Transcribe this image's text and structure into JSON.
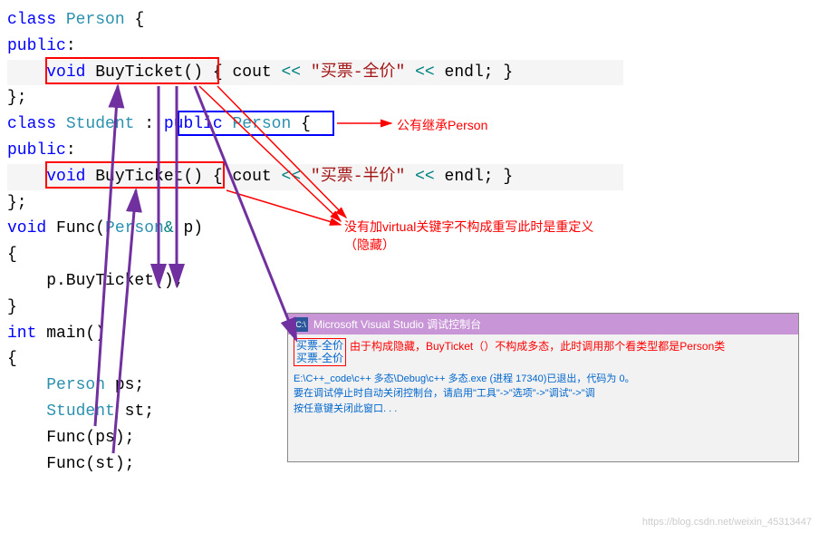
{
  "code": {
    "l1_class": "class",
    "l1_person": "Person",
    "l1_brace": " {",
    "l2_public": "public",
    "l2_colon": ":",
    "l3_void": "void",
    "l3_fn": " BuyTicket",
    "l3_parens": "()",
    "l3_open": " { ",
    "l3_cout": "cout",
    "l3_op1": " << ",
    "l3_str": "\"买票-全价\"",
    "l3_op2": " << ",
    "l3_endl": "endl",
    "l3_semi": "; }",
    "l4_close": "};",
    "l5_class": "class",
    "l5_student": "Student",
    "l5_colon": " : ",
    "l5_public": "public",
    "l5_person": " Person",
    "l5_brace": " {",
    "l6_public": "public",
    "l6_colon": ":",
    "l7_void": "void",
    "l7_fn": " BuyTicket",
    "l7_parens": "()",
    "l7_open": " { ",
    "l7_cout": "cout",
    "l7_op1": " << ",
    "l7_str": "\"买票-半价\"",
    "l7_op2": " << ",
    "l7_endl": "endl",
    "l7_semi": "; }",
    "l8_close": "};",
    "l9_void": "void",
    "l9_fn": " Func(",
    "l9_person": "Person",
    "l9_amp": "&",
    "l9_p": " p)",
    "l10_brace": "{",
    "l11_call": "    p.BuyTicket();",
    "l12_brace": "}",
    "l13_int": "int",
    "l13_main": " main()",
    "l14_brace": "{",
    "l15_person": "Person",
    "l15_ps": " ps;",
    "l16_student": "Student",
    "l16_st": " st;",
    "l17_func": "    Func(ps);",
    "l18_func": "    Func(st);"
  },
  "annotations": {
    "inherit": "公有继承Person",
    "novirtual1": "没有加virtual关键字不构成重写此时是重定义",
    "novirtual2": "（隐藏）",
    "console_note": "由于构成隐藏，BuyTicket（）不构成多态，此时调用那个看类型都是Person类"
  },
  "console": {
    "title": "Microsoft Visual Studio 调试控制台",
    "icon": "C:\\",
    "out1": "买票-全价",
    "out2": "买票-全价",
    "path": "E:\\C++_code\\c++ 多态\\Debug\\c++ 多态.exe (进程 17340)已退出，代码为 0。\n要在调试停止时自动关闭控制台，请启用\"工具\"->\"选项\"->\"调试\"->\"调\n按任意键关闭此窗口. . ."
  },
  "watermark": "https://blog.csdn.net/weixin_45313447"
}
